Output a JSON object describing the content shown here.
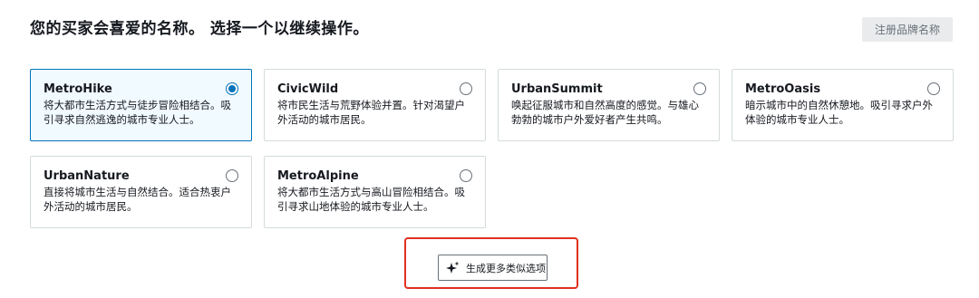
{
  "header": {
    "title": "您的买家会喜爱的名称。 选择一个以继续操作。",
    "register_button_label": "注册品牌名称"
  },
  "options": [
    {
      "name": "MetroHike",
      "description": "将大都市生活方式与徒步冒险相结合。吸引寻求自然逃逸的城市专业人士。",
      "selected": true
    },
    {
      "name": "CivicWild",
      "description": "将市民生活与荒野体验并置。针对渴望户外活动的城市居民。",
      "selected": false
    },
    {
      "name": "UrbanSummit",
      "description": "唤起征服城市和自然高度的感觉。与雄心勃勃的城市户外爱好者产生共鸣。",
      "selected": false
    },
    {
      "name": "MetroOasis",
      "description": "暗示城市中的自然休憩地。吸引寻求户外体验的城市专业人士。",
      "selected": false
    },
    {
      "name": "UrbanNature",
      "description": "直接将城市生活与自然结合。适合热衷户外活动的城市居民。",
      "selected": false
    },
    {
      "name": "MetroAlpine",
      "description": "将大都市生活方式与高山冒险相结合。吸引寻求山地体验的城市专业人士。",
      "selected": false
    }
  ],
  "generate_button": {
    "label": "生成更多类似选项",
    "icon": "sparkle-icon"
  },
  "colors": {
    "selected_border": "#0073bb",
    "selected_background": "#f1faff",
    "highlight_frame": "#e0301e",
    "disabled_button_background": "#e9ebed"
  }
}
